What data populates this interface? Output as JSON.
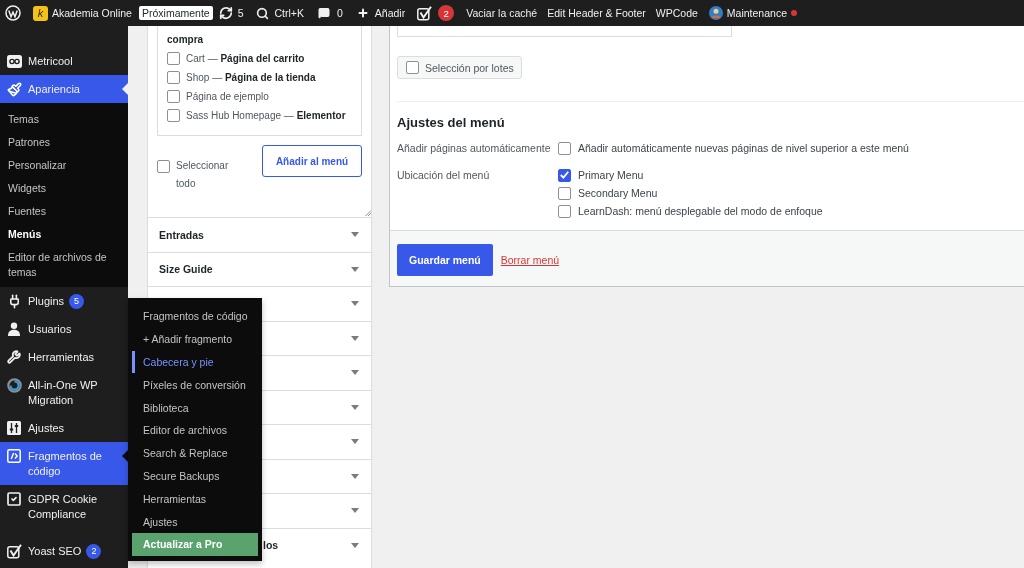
{
  "admin_bar": {
    "items": [
      {
        "kind": "logo"
      },
      {
        "kind": "site",
        "icon_letter": "k",
        "label": "Akademia Online"
      },
      {
        "kind": "tag",
        "label": "Próximamente"
      },
      {
        "kind": "updates",
        "label": "5"
      },
      {
        "kind": "search",
        "label": "Ctrl+K"
      },
      {
        "kind": "comments",
        "label": "0"
      },
      {
        "kind": "new",
        "label": "Añadir"
      },
      {
        "kind": "seo",
        "badge": "2"
      },
      {
        "kind": "link",
        "label": "Vaciar la caché"
      },
      {
        "kind": "link",
        "label": "Edit Header & Footer"
      },
      {
        "kind": "link",
        "label": "WPCode"
      },
      {
        "kind": "maintenance",
        "label": "Maintenance",
        "active": true
      }
    ]
  },
  "sidebar": {
    "items": [
      {
        "kind": "menu",
        "label": "Metricool",
        "selected": false,
        "expanded": false
      },
      {
        "kind": "menu",
        "label": "Apariencia",
        "selected": true,
        "expanded": false,
        "children": [
          {
            "label": "Temas",
            "selected": false
          },
          {
            "label": "Patrones",
            "selected": false
          },
          {
            "label": "Personalizar",
            "selected": false
          },
          {
            "label": "Widgets",
            "selected": false
          },
          {
            "label": "Fuentes",
            "selected": false
          },
          {
            "label": "Menús",
            "selected": true
          },
          {
            "label": "Editor de archivos de temas",
            "selected": false
          }
        ]
      },
      {
        "kind": "menu",
        "label": "Plugins",
        "badge": "5",
        "selected": false,
        "expanded": false
      },
      {
        "kind": "menu",
        "label": "Usuarios",
        "selected": false,
        "expanded": false
      },
      {
        "kind": "menu",
        "label": "Herramientas",
        "selected": false,
        "expanded": false
      },
      {
        "kind": "menu",
        "label": "All-in-One WP Migration",
        "selected": false,
        "expanded": false
      },
      {
        "kind": "menu",
        "label": "Ajustes",
        "selected": false,
        "expanded": false
      },
      {
        "kind": "menu",
        "label": "Fragmentos de código",
        "selected": false,
        "expanded": true
      },
      {
        "kind": "menu",
        "label": "GDPR Cookie Compliance",
        "selected": false,
        "expanded": false
      },
      {
        "kind": "separator"
      },
      {
        "kind": "menu",
        "label": "Yoast SEO",
        "badge": "2",
        "selected": false,
        "expanded": false
      }
    ]
  },
  "flyout_menu": {
    "items": [
      {
        "kind": "link",
        "label": "Fragmentos de código",
        "selected": false
      },
      {
        "kind": "link",
        "label": "+ Añadir fragmento",
        "selected": false
      },
      {
        "kind": "link",
        "label": "Cabecera y pie",
        "selected": true
      },
      {
        "kind": "link",
        "label": "Píxeles de conversión",
        "selected": false
      },
      {
        "kind": "link",
        "label": "Biblioteca",
        "selected": false
      },
      {
        "kind": "link",
        "label": "Editor de archivos",
        "selected": false
      },
      {
        "kind": "link",
        "label": "Search & Replace",
        "selected": false
      },
      {
        "kind": "link",
        "label": "Secure Backups",
        "selected": false
      },
      {
        "kind": "link",
        "label": "Herramientas",
        "selected": false
      },
      {
        "kind": "link",
        "label": "Ajustes",
        "selected": false
      },
      {
        "kind": "upgrade",
        "label": "Actualizar a Pro",
        "selected": false
      }
    ]
  },
  "add_items_panel": {
    "cut_item_text": "compra",
    "items": [
      {
        "label": "Cart — **Página del carrito**",
        "checked": false
      },
      {
        "label": "Shop — **Página de la tienda**",
        "checked": false
      },
      {
        "label": "Página de ejemplo",
        "checked": false
      },
      {
        "label": "Sass Hub Homepage — **Elementor**",
        "checked": false
      }
    ],
    "select_all": {
      "label": "Seleccionar todo",
      "checked": false
    },
    "add_button": "Añadir al menú"
  },
  "accordion": [
    {
      "title": "Entradas",
      "expanded": false
    },
    {
      "title": "Size Guide",
      "expanded": false
    },
    {
      "expanded": false
    },
    {
      "expanded": false
    },
    {
      "expanded": false
    },
    {
      "expanded": false
    },
    {
      "expanded": false
    },
    {
      "expanded": false
    },
    {
      "expanded": false
    },
    {
      "title": "los",
      "expanded": false,
      "behind_flyout": true
    }
  ],
  "menu_structure": {
    "bulk_select": {
      "label": "Selección por lotes",
      "checked": false
    }
  },
  "menu_settings": {
    "title": "Ajustes del menú",
    "rows": [
      {
        "label": "Añadir páginas automáticamente",
        "options": [
          {
            "label": "Añadir automáticamente nuevas páginas de nivel superior a este menú",
            "checked": false
          }
        ]
      },
      {
        "label": "Ubicación del menú",
        "options": [
          {
            "label": "Primary Menu",
            "checked": true
          },
          {
            "label": "Secondary Menu",
            "checked": false
          },
          {
            "label": "LearnDash: menú desplegable del modo de enfoque",
            "checked": false
          }
        ]
      }
    ]
  },
  "menu_footer": {
    "save_button": "Guardar menú",
    "delete_link": "Borrar menú"
  }
}
